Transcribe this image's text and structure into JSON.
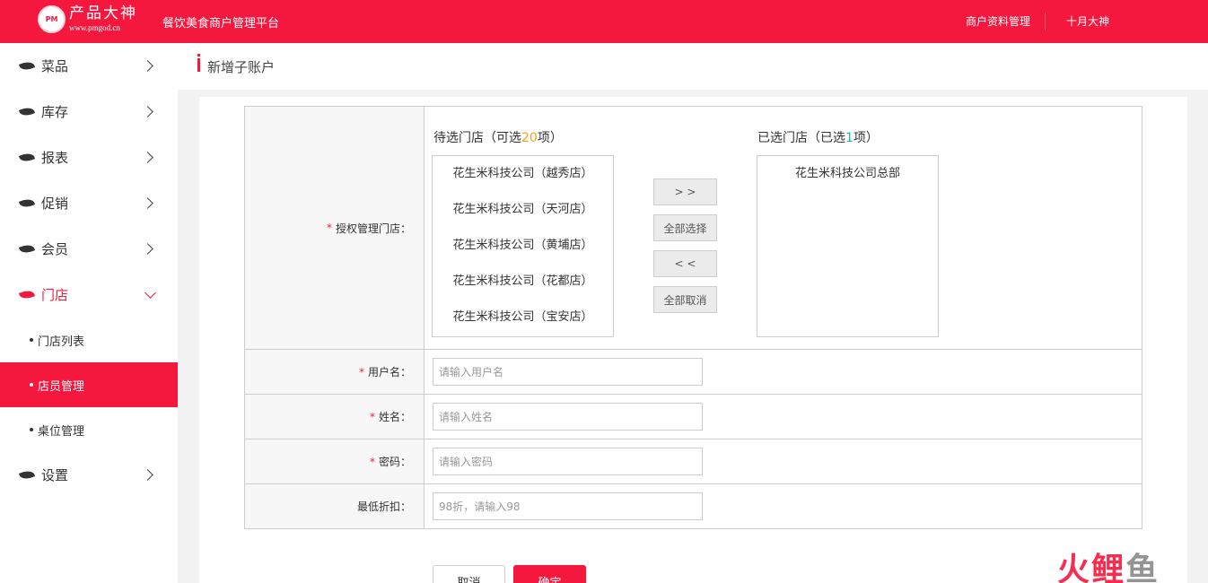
{
  "header": {
    "logo_name": "产品大神",
    "logo_url": "www.pmgod.cn",
    "logo_mark": "PM",
    "platform_title": "餐饮美食商户管理平台",
    "merchant_link": "商户资料管理",
    "user_name": "十月大神",
    "brand_color": "#f5183e"
  },
  "sidebar": {
    "items": [
      {
        "label": "菜品",
        "icon": "leaf-icon"
      },
      {
        "label": "库存",
        "icon": "leaf-icon"
      },
      {
        "label": "报表",
        "icon": "leaf-icon"
      },
      {
        "label": "促销",
        "icon": "leaf-icon"
      },
      {
        "label": "会员",
        "icon": "leaf-icon"
      },
      {
        "label": "门店",
        "icon": "leaf-icon",
        "expanded": true
      },
      {
        "label": "设置",
        "icon": "leaf-icon"
      }
    ],
    "sub_items": [
      {
        "label": "门店列表"
      },
      {
        "label": "店员管理",
        "active": true
      },
      {
        "label": "桌位管理"
      }
    ]
  },
  "page": {
    "title": "新增子账户"
  },
  "form": {
    "store_label": "授权管理门店：",
    "available": {
      "title_prefix": "待选门店（可选",
      "count": "20",
      "title_suffix": "项）",
      "items": [
        "花生米科技公司（越秀店）",
        "花生米科技公司（天河店）",
        "花生米科技公司（黄埔店）",
        "花生米科技公司（花都店）",
        "花生米科技公司（宝安店）"
      ]
    },
    "selected": {
      "title_prefix": "已选门店（已选",
      "count": "1",
      "title_suffix": "项）",
      "items": [
        "花生米科技公司总部"
      ]
    },
    "buttons": {
      "move_right": "> >",
      "select_all": "全部选择",
      "move_left": "< <",
      "deselect_all": "全部取消"
    },
    "username": {
      "label": "用户名：",
      "placeholder": "请输入用户名",
      "value": ""
    },
    "name": {
      "label": "姓名：",
      "placeholder": "请输入姓名",
      "value": ""
    },
    "password": {
      "label": "密码：",
      "placeholder": "请输入密码",
      "value": ""
    },
    "discount": {
      "label": "最低折扣：",
      "placeholder": "98折，请输入98",
      "value": ""
    },
    "required_mark": "*"
  },
  "actions": {
    "cancel": "取消",
    "confirm": "确定"
  },
  "watermark": {
    "part1": "火",
    "part2": "鲤",
    "part3": "鱼"
  }
}
